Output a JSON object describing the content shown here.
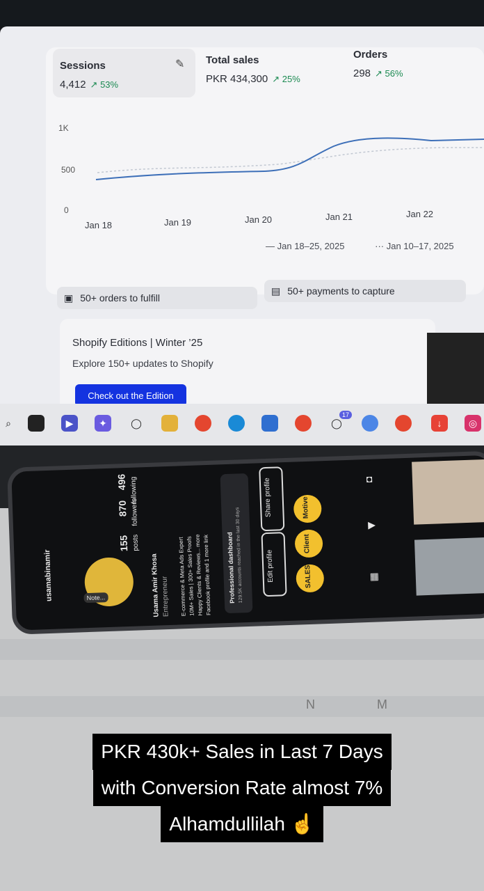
{
  "dashboard": {
    "sessions": {
      "label": "Sessions",
      "value": "4,412",
      "change": "53%"
    },
    "total_sales": {
      "label": "Total sales",
      "value": "PKR 434,300",
      "change": "25%"
    },
    "orders": {
      "label": "Orders",
      "value": "298",
      "change": "56%"
    },
    "y_ticks": [
      "1K",
      "500",
      "0"
    ],
    "x_ticks": [
      "Jan 18",
      "Jan 19",
      "Jan 20",
      "Jan 21",
      "Jan 22"
    ],
    "legend": {
      "current": "Jan 18–25, 2025",
      "previous": "Jan 10–17, 2025"
    }
  },
  "tasks": {
    "fulfill": "50+ orders to fulfill",
    "capture": "50+ payments to capture"
  },
  "edition": {
    "title": "Shopify Editions | Winter ’25",
    "subtitle": "Explore 150+ updates to Shopify",
    "cta": "Check out the Edition"
  },
  "phone": {
    "username": "usamabinamir",
    "posts": "155",
    "posts_label": "posts",
    "followers": "870",
    "followers_label": "followers",
    "following": "496",
    "following_label": "following",
    "name": "Usama Amir Khosa",
    "category": "Entrepreneur",
    "bio1": "E-commerce & Meta Ads Expert",
    "bio2": "10M+ Sales | 300+ Sales Proofs",
    "bio3": "Happy Clients & Reviews... more",
    "bio4": "Facebook profile and 1 more link",
    "dashboard_label": "Professional dashboard",
    "dashboard_sub": "129.5K accounts reached in the last 30 days",
    "edit_profile": "Edit profile",
    "share_profile": "Share profile",
    "highlights": [
      "SALES",
      "Client",
      "Motive"
    ],
    "note": "Note..."
  },
  "taskbar_badge": "17",
  "caption": {
    "line1": "PKR 430k+ Sales in Last 7 Days",
    "line2": "with Conversion Rate almost 7%",
    "line3": "Alhamdullilah ☝️"
  },
  "keys": [
    "N",
    "M"
  ],
  "colors": {
    "positive": "#1c8a52",
    "cta": "#1433e0",
    "chart_line": "#3d6fb8"
  }
}
